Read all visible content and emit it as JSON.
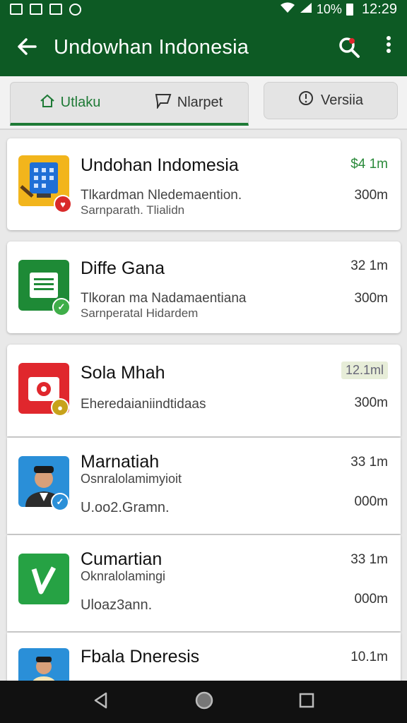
{
  "statusbar": {
    "battery_text": "10%",
    "time": "12:29"
  },
  "appbar": {
    "title": "Undowhan Indonesia"
  },
  "tabs": [
    {
      "label": "Utlaku",
      "icon": "home-icon",
      "active": true
    },
    {
      "label": "Nlarpet",
      "icon": "chat-icon",
      "active": false
    },
    {
      "label": "Versiia",
      "icon": "pin-icon",
      "active": false
    }
  ],
  "items": [
    {
      "name": "Undohan Indomesia",
      "line1": "Tlkardman Nledemaention.",
      "line2": "Sarnparath. Tlialidn",
      "val1": "$4 1m",
      "val2": "300m",
      "icon": "calendar-app-icon",
      "badge": "heart-badge-icon",
      "accent": "#f2b51c",
      "badge_color": "#d92a2a"
    },
    {
      "name": "Diffe Gana",
      "line1": "Tlkoran ma Nadamaentiana",
      "line2": "Sarnperatal Hidardem",
      "val1": "32 1m",
      "val2": "300m",
      "icon": "document-app-icon",
      "badge": "check-badge-icon",
      "accent": "#1e8a36",
      "badge_color": "#3fae49"
    },
    {
      "name": "Sola Mhah",
      "line1": "Eheredaianiindtidaas",
      "line2": "",
      "val1": "12.1ml",
      "val2": "300m",
      "icon": "camera-app-icon",
      "badge": "coin-badge-icon",
      "accent": "#e0272d",
      "badge_color": "#c7a21b"
    },
    {
      "name": "Marnatiah",
      "line1": "Osnralolamimyioit",
      "line2": "U.oo2.Gramn.",
      "val1": "33 1m",
      "val2": "000m",
      "icon": "profile-photo-icon",
      "badge": "verified-badge-icon",
      "accent": "#2a8fd8",
      "badge_color": "#2a8fd8"
    },
    {
      "name": "Cumartian",
      "line1": "Oknralolamingi",
      "line2": "Uloaz3ann.",
      "val1": "33 1m",
      "val2": "000m",
      "icon": "vine-app-icon",
      "badge": "",
      "accent": "#26a244",
      "badge_color": ""
    },
    {
      "name": "Fbala Dneresis",
      "line1": "",
      "line2": "",
      "val1": "10.1m",
      "val2": "",
      "icon": "person-app-icon",
      "badge": "",
      "accent": "#2a8fd8",
      "badge_color": ""
    }
  ]
}
